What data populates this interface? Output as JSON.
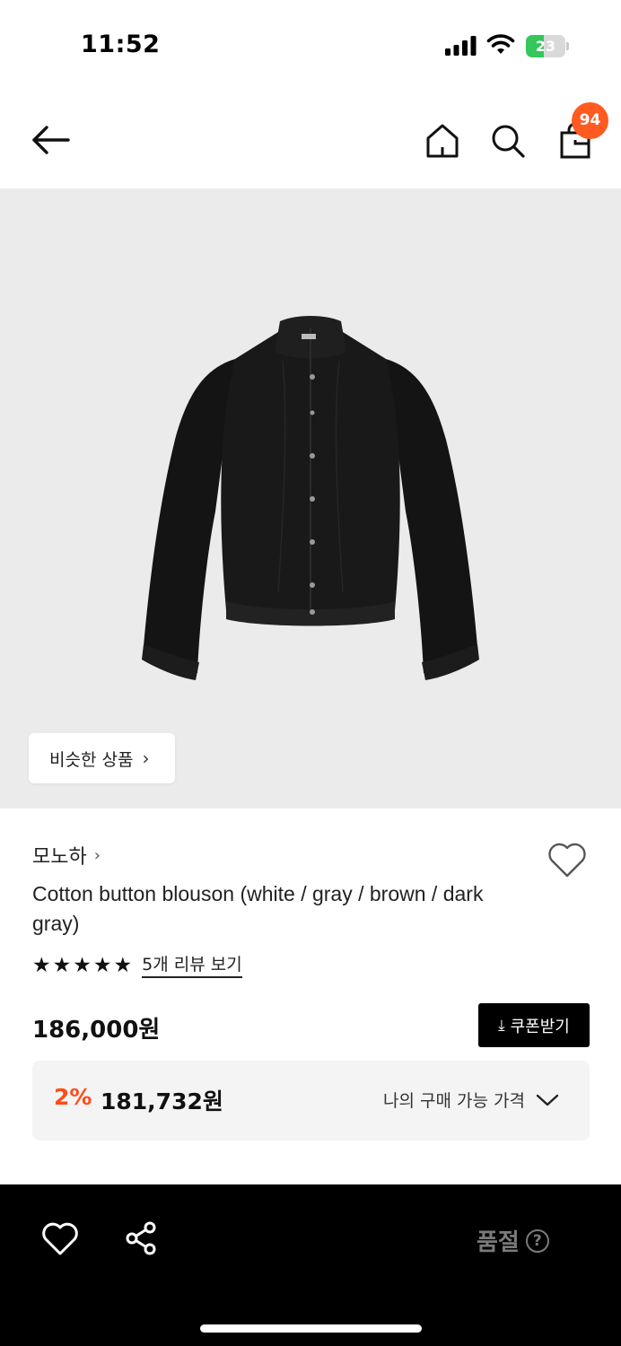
{
  "status_bar": {
    "time": "11:52",
    "battery_level": "23",
    "icons": [
      "signal-icon",
      "wifi-icon",
      "battery-icon"
    ]
  },
  "nav": {
    "icons": [
      "back-arrow-icon",
      "home-icon",
      "search-icon",
      "shopping-bag-icon"
    ],
    "cart_count": "94"
  },
  "product": {
    "similar_label": "비슷한 상품",
    "brand": "모노하",
    "title": "Cotton button blouson (white / gray / brown / dark gray)",
    "rating_stars": 5,
    "review_link": "5개 리뷰 보기",
    "price": "186,000원",
    "coupon_label": "쿠폰받기",
    "discount_rate": "2%",
    "sale_price": "181,732원",
    "price_dropdown_label": "나의 구매 가능 가격"
  },
  "bottom_bar": {
    "status": "품절",
    "help_symbol": "?",
    "icons": [
      "heart-icon",
      "share-icon",
      "help-icon"
    ]
  },
  "colors": {
    "accent": "#ff5a1f",
    "discount": "#ff4d17",
    "battery": "#34c759",
    "image_background": "#ebebeb",
    "bottom_bar": "#000000"
  }
}
